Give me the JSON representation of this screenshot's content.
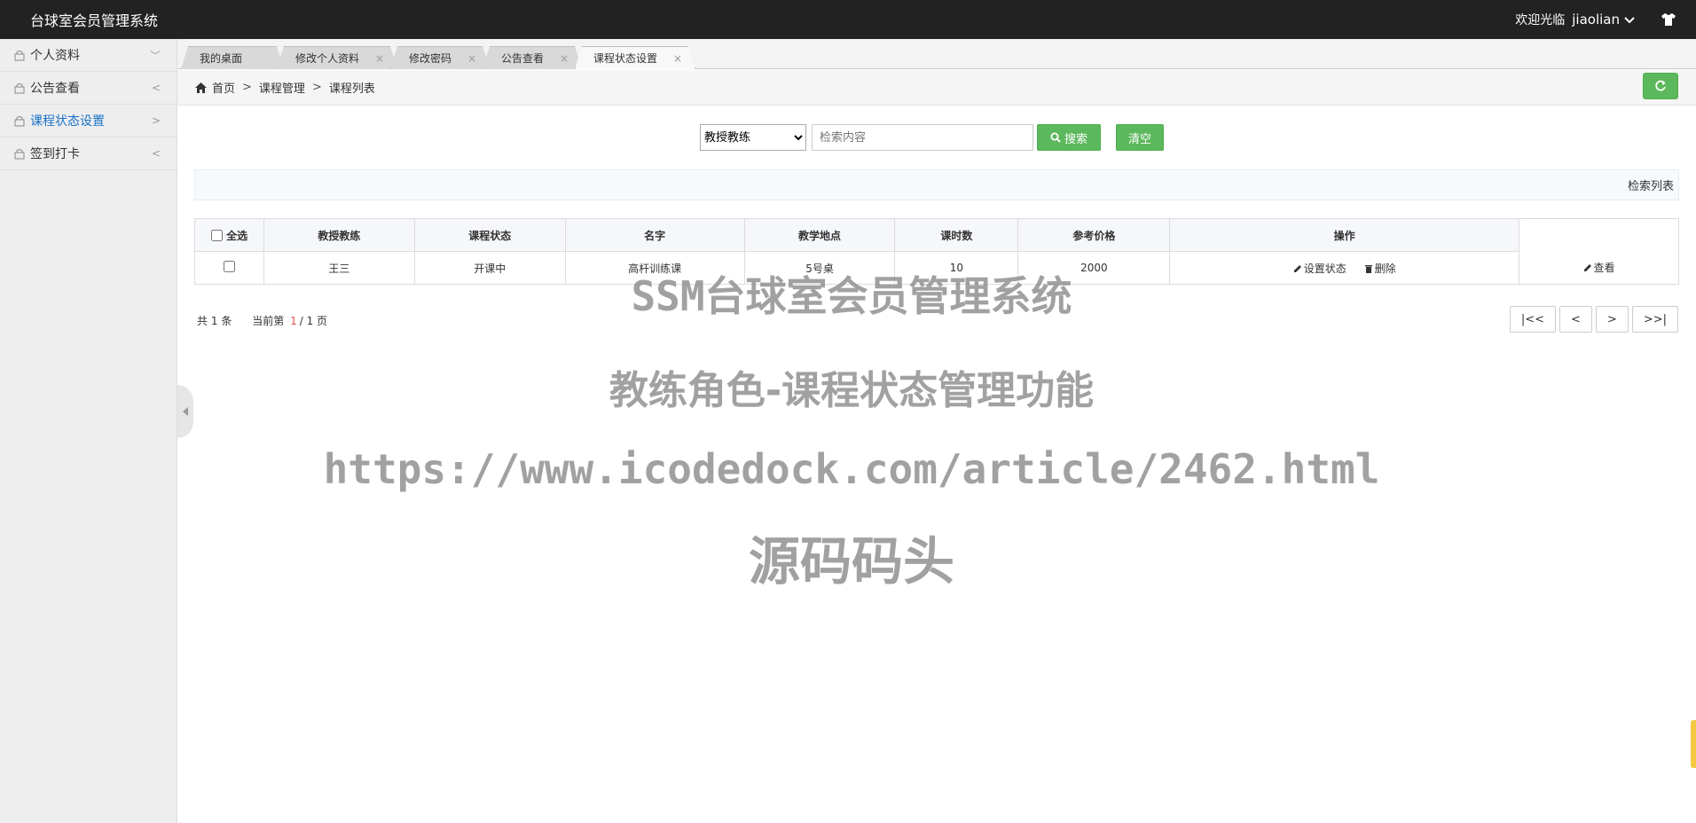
{
  "app": {
    "title": "台球室会员管理系统"
  },
  "user": {
    "welcome": "欢迎光临",
    "name": "jiaolian"
  },
  "sidebar": {
    "items": [
      {
        "label": "个人资料",
        "arrow": "﹀"
      },
      {
        "label": "公告查看",
        "arrow": "<"
      },
      {
        "label": "课程状态设置",
        "arrow": ">"
      },
      {
        "label": "签到打卡",
        "arrow": "<"
      }
    ]
  },
  "tabs": [
    {
      "label": "我的桌面"
    },
    {
      "label": "修改个人资料",
      "close": "×"
    },
    {
      "label": "修改密码",
      "close": "×"
    },
    {
      "label": "公告查看",
      "close": "×"
    },
    {
      "label": "课程状态设置",
      "close": "×"
    }
  ],
  "breadcrumb": {
    "home": "首页",
    "sep": ">",
    "level1": "课程管理",
    "level2": "课程列表"
  },
  "search": {
    "field": "教授教练",
    "placeholder": "检索内容",
    "search_label": "搜索",
    "clear_label": "清空"
  },
  "list_title": "检索列表",
  "table": {
    "select_all": "全选",
    "columns": [
      "教授教练",
      "课程状态",
      "名字",
      "教学地点",
      "课时数",
      "参考价格",
      "操作"
    ],
    "rows": [
      {
        "coach": "王三",
        "status": "开课中",
        "name": "高杆训练课",
        "location": "5号桌",
        "hours": "10",
        "price": "2000",
        "set_status": "设置状态",
        "delete": "删除",
        "view": "查看"
      }
    ]
  },
  "pager": {
    "total_prefix": "共",
    "total": "1",
    "total_suffix": "条",
    "current_prefix": "当前第",
    "current": "1",
    "divider": "/",
    "pages": "1",
    "pages_suffix": "页",
    "first": "|<<",
    "prev": "<",
    "next": ">",
    "last": ">>|"
  },
  "watermark": {
    "line1": "SSM台球室会员管理系统",
    "line2": "教练角色-课程状态管理功能",
    "line3": "https://www.icodedock.com/article/2462.html",
    "line4": "源码码头"
  },
  "colors": {
    "topbar": "#222222",
    "accent_green": "#5cb85c",
    "active_link": "#1a73c8",
    "current_page": "#d9534f"
  }
}
